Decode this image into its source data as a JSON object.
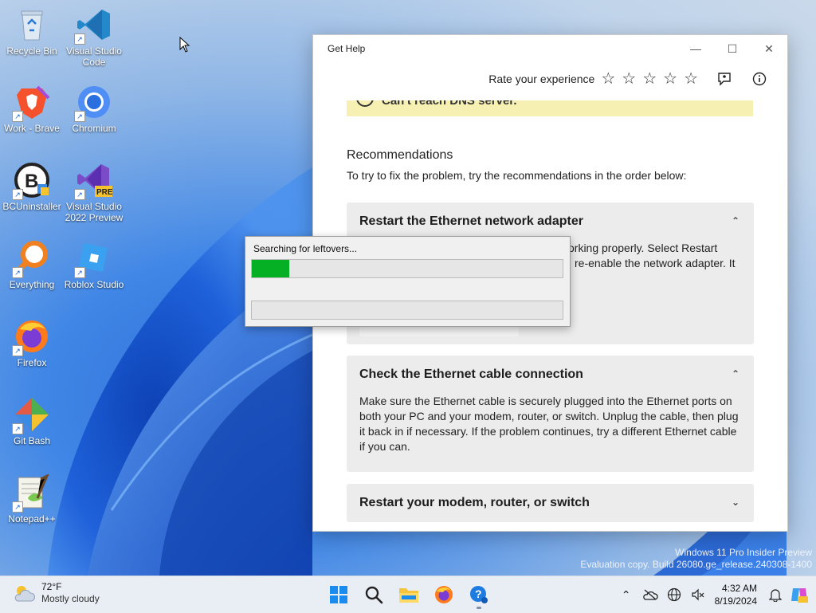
{
  "desktop": {
    "icons": [
      {
        "label": "Recycle Bin",
        "icon": "recycle-bin-icon"
      },
      {
        "label": "Visual Studio Code",
        "icon": "vscode-icon"
      },
      {
        "label": "Work - Brave",
        "icon": "brave-icon"
      },
      {
        "label": "Chromium",
        "icon": "chromium-icon"
      },
      {
        "label": "BCUninstaller",
        "icon": "bcuninstaller-icon"
      },
      {
        "label": "Visual Studio 2022 Preview",
        "icon": "visual-studio-preview-icon",
        "badge": "PRE"
      },
      {
        "label": "Everything",
        "icon": "everything-search-icon"
      },
      {
        "label": "Roblox Studio",
        "icon": "roblox-studio-icon"
      },
      {
        "label": "Firefox",
        "icon": "firefox-icon"
      },
      {
        "label": "Git Bash",
        "icon": "git-bash-icon"
      },
      {
        "label": "Notepad++",
        "icon": "notepad-plus-plus-icon"
      }
    ]
  },
  "get_help": {
    "title": "Get Help",
    "rate_label": "Rate your experience",
    "rating_stars": 0,
    "rating_max": 5,
    "notice_text": "Can't reach DNS server.",
    "recommendations_title": "Recommendations",
    "recommendations_sub": "To try to fix the problem, try the recommendations in the order below:",
    "cards": [
      {
        "title": "Restart the Ethernet network adapter",
        "body_line1": "orking properly. Select Restart",
        "body_line2": "re-enable the network adapter. It",
        "expanded": true
      },
      {
        "title": "Check the Ethernet cable connection",
        "body": "Make sure the Ethernet cable is securely plugged into the Ethernet ports on both your PC and your modem, router, or switch. Unplug the cable, then plug it back in if necessary. If the problem continues, try a different Ethernet cable if you can.",
        "expanded": true
      },
      {
        "title": "Restart your modem, router, or switch",
        "expanded": false
      }
    ]
  },
  "progress_dialog": {
    "status_text": "Searching for leftovers...",
    "progress_primary": 0.12,
    "progress_secondary": 0.0,
    "fill_color": "#06b025"
  },
  "watermark": {
    "line1": "Windows 11 Pro Insider Preview",
    "line2": "Evaluation copy. Build 26080.ge_release.240308-1400"
  },
  "taskbar": {
    "weather_temp": "72°F",
    "weather_condition": "Mostly cloudy",
    "time": "4:32 AM",
    "date": "8/19/2024",
    "pinned": [
      "start-icon",
      "search-icon",
      "file-explorer-icon",
      "firefox-icon",
      "get-help-icon"
    ]
  }
}
